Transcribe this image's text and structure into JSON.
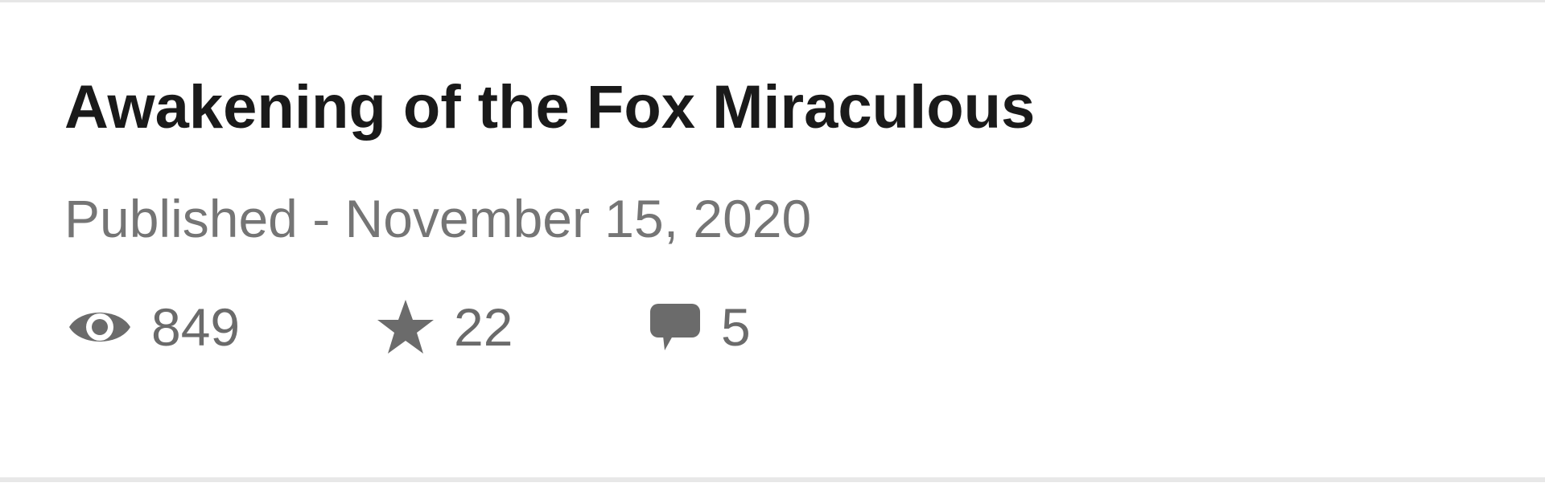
{
  "story": {
    "title": "Awakening of the Fox Miraculous",
    "published_label": "Published",
    "separator": "-",
    "published_date": "November 15, 2020",
    "published_text": "Published - November 15, 2020"
  },
  "stats": {
    "views": {
      "icon": "eye-icon",
      "value": "849"
    },
    "stars": {
      "icon": "star-icon",
      "value": "22"
    },
    "comments": {
      "icon": "comment-bubble-icon",
      "value": "5"
    }
  },
  "colors": {
    "title": "#1a1a1a",
    "meta": "#757575",
    "icon": "#6b6b6b",
    "divider": "#e6e6e6"
  }
}
